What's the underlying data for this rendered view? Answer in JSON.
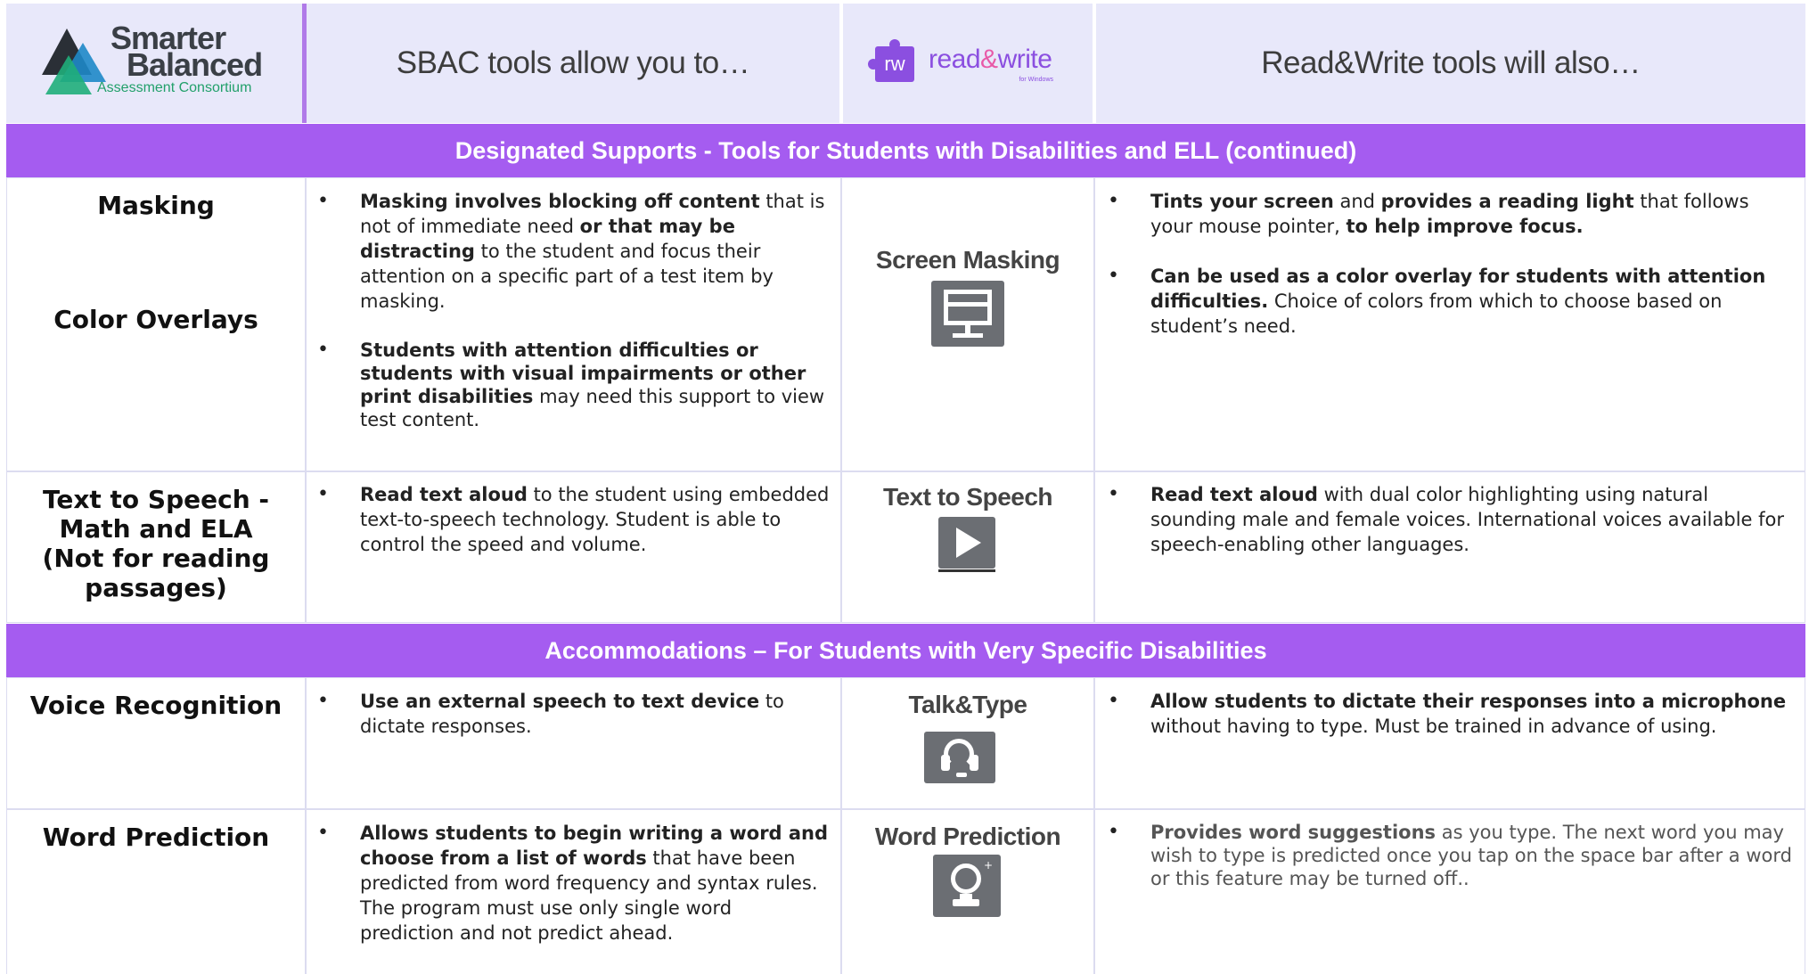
{
  "header": {
    "logo": {
      "line1": "Smarter",
      "line2": "Balanced",
      "line3": "Assessment Consortium"
    },
    "sbac_heading": "SBAC tools allow you to…",
    "rw_logo": {
      "badge": "rw",
      "word1": "read",
      "amp": "&",
      "word2": "write",
      "sub": "for Windows"
    },
    "rw_heading": "Read&Write tools will also…"
  },
  "bands": {
    "designated": "Designated Supports - Tools for Students with Disabilities and ELL (continued)",
    "accommodations": "Accommodations – For Students with Very Specific Disabilities"
  },
  "rows": {
    "masking": {
      "label_a": "Masking",
      "label_b": "Color Overlays",
      "sbac1": {
        "b1": "Masking involves blocking off content",
        "t1": " that is not of immediate need ",
        "b2": "or that may be distracting",
        "t2": " to the student and focus their attention on a specific part of a test item by masking."
      },
      "sbac2": {
        "b1": "Students with attention difficulties or students with visual impairments or other print disabilities",
        "t1": " may need this support to view test content."
      },
      "tool": "Screen Masking",
      "icon": "monitor-icon",
      "rw1": {
        "b1": "Tints your screen",
        "t1": " and ",
        "b2": "provides a reading light",
        "t2": " that follows your mouse pointer, ",
        "b3": "to help improve focus."
      },
      "rw2": {
        "b1": "Can be used as a color overlay for students with attention difficulties.",
        "t1": "  Choice of colors from which to choose based on student’s need."
      }
    },
    "tts": {
      "label_1": "Text to Speech -",
      "label_2": "Math and ELA",
      "label_3": "(Not for reading",
      "label_4": "passages)",
      "sbac1": {
        "b1": "Read text aloud",
        "t1": " to the student using embedded text-to-speech technology.  Student is able to control the speed and volume."
      },
      "tool": "Text to Speech",
      "icon": "play-icon",
      "rw1": {
        "b1": "Read text aloud",
        "t1": " with dual color highlighting using natural sounding male and female voices. International voices available for speech-enabling other languages."
      }
    },
    "voice": {
      "label": "Voice Recognition",
      "sbac1": {
        "b1": "Use an external speech to text device",
        "t1": " to dictate responses."
      },
      "tool": "Talk&Type",
      "icon": "headset-icon",
      "rw1": {
        "b1": "Allow students to dictate their responses into a microphone",
        "t1": " without having to type. Must be trained in advance of using."
      }
    },
    "wordpred": {
      "label": "Word Prediction",
      "sbac1": {
        "b1": "Allows students to begin writing a word and choose from a list of words",
        "t1": " that have been predicted from word frequency and syntax rules. The program must use only single word prediction and not predict ahead."
      },
      "tool": "Word Prediction",
      "icon": "crystal-ball-icon",
      "rw1": {
        "b1": "Provides word suggestions",
        "t1": " as you type.  The next word you may wish to type is predicted once you tap on the space bar after a word or this feature may be turned off.."
      }
    }
  },
  "bullet": "•",
  "colors": {
    "band": "#a55cf0",
    "header_bg": "#e8e8fa",
    "icon_bg": "#6b6e73",
    "rw_purple": "#8b4fe0"
  }
}
